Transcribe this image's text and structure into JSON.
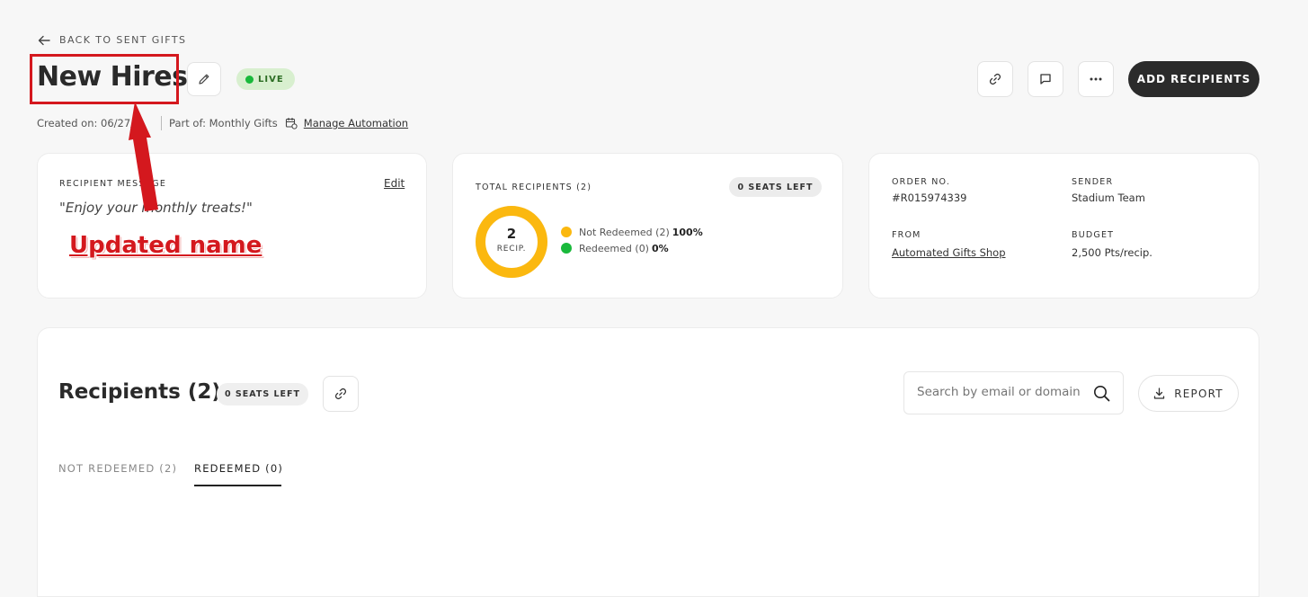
{
  "header": {
    "back_label": "BACK TO SENT GIFTS",
    "title": "New Hires",
    "live_label": "LIVE",
    "add_recipients_label": "ADD RECIPIENTS",
    "created_on": "Created on: 06/27/",
    "part_of": "Part of: Monthly Gifts",
    "manage_automation": "Manage Automation"
  },
  "annotation": {
    "text": "Updated name",
    "color": "#d4181e"
  },
  "message_card": {
    "label": "RECIPIENT MESSAGE",
    "edit_label": "Edit",
    "message": "\"Enjoy your monthly treats!\""
  },
  "recipients_card": {
    "label": "TOTAL RECIPIENTS (2)",
    "seats_left": "0 SEATS LEFT",
    "donut_count": "2",
    "donut_unit": "RECIP.",
    "not_redeemed_label": "Not Redeemed (2)",
    "not_redeemed_pct": "100%",
    "redeemed_label": "Redeemed (0)",
    "redeemed_pct": "0%",
    "not_redeemed_fraction": 1.0,
    "colors": {
      "not_redeemed": "#fbb80f",
      "redeemed": "#19b93b"
    }
  },
  "order_card": {
    "order_label": "ORDER NO.",
    "order_value": "#R015974339",
    "sender_label": "SENDER",
    "sender_value": "Stadium Team",
    "from_label": "FROM",
    "from_value": "Automated Gifts Shop",
    "budget_label": "BUDGET",
    "budget_value": "2,500 Pts/recip."
  },
  "recipients_section": {
    "title": "Recipients (2)",
    "seats_left": "0 SEATS LEFT",
    "search_placeholder": "Search by email or domain",
    "report_label": "REPORT",
    "tabs": [
      {
        "label": "NOT REDEEMED (2)",
        "active": false
      },
      {
        "label": "REDEEMED (0)",
        "active": true
      }
    ]
  }
}
